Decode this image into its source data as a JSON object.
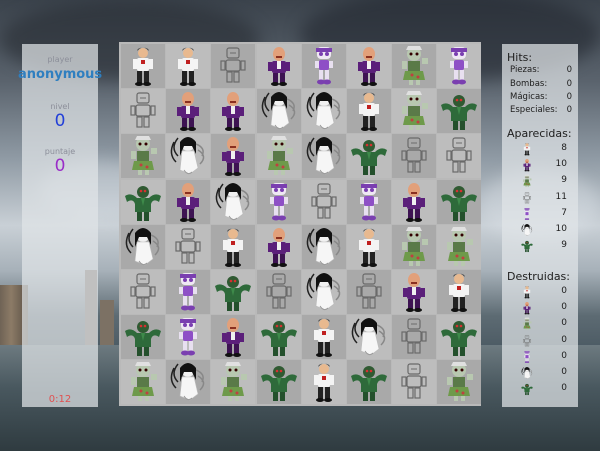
{
  "left_panel": {
    "player_label": "player",
    "player_name": "anonymous",
    "level_label": "nivel",
    "level_value": "0",
    "score_label": "puntaje",
    "score_value": "0",
    "timer": "0:12"
  },
  "right_panel": {
    "hits_title": "Hits:",
    "hits": [
      {
        "label": "Piezas:",
        "value": "0"
      },
      {
        "label": "Bombas:",
        "value": "0"
      },
      {
        "label": "Mágicas:",
        "value": "0"
      },
      {
        "label": "Especiales:",
        "value": "0"
      }
    ],
    "appeared_title": "Aparecidas:",
    "appeared": [
      {
        "icon": "man-white-shirt-icon",
        "value": "8"
      },
      {
        "icon": "bald-man-purple-suit-icon",
        "value": "10"
      },
      {
        "icon": "zombie-girl-icon",
        "value": "9"
      },
      {
        "icon": "gray-robot-icon",
        "value": "11"
      },
      {
        "icon": "purple-robot-icon",
        "value": "7"
      },
      {
        "icon": "ghost-girl-icon",
        "value": "10"
      },
      {
        "icon": "green-monster-icon",
        "value": "9"
      }
    ],
    "destroyed_title": "Destruidas:",
    "destroyed": [
      {
        "icon": "man-white-shirt-icon",
        "value": "0"
      },
      {
        "icon": "bald-man-purple-suit-icon",
        "value": "0"
      },
      {
        "icon": "zombie-girl-icon",
        "value": "0"
      },
      {
        "icon": "gray-robot-icon",
        "value": "0"
      },
      {
        "icon": "purple-robot-icon",
        "value": "0"
      },
      {
        "icon": "ghost-girl-icon",
        "value": "0"
      },
      {
        "icon": "green-monster-icon",
        "value": "0"
      }
    ]
  },
  "board": {
    "rows": [
      [
        "man",
        "man",
        "robot",
        "bald",
        "purple",
        "bald",
        "zombie",
        "purple"
      ],
      [
        "robot",
        "bald",
        "bald",
        "ghost",
        "ghost",
        "man",
        "zombie",
        "monster"
      ],
      [
        "zombie",
        "ghost",
        "bald",
        "zombie",
        "ghost",
        "monster",
        "robot",
        "robot"
      ],
      [
        "monster",
        "bald",
        "ghost",
        "purple",
        "robot",
        "purple",
        "bald",
        "monster"
      ],
      [
        "ghost",
        "robot",
        "man",
        "bald",
        "ghost",
        "man",
        "zombie",
        "zombie"
      ],
      [
        "robot",
        "purple",
        "monster",
        "robot",
        "ghost",
        "robot",
        "bald",
        "man"
      ],
      [
        "monster",
        "purple",
        "bald",
        "monster",
        "man",
        "ghost",
        "robot",
        "monster"
      ],
      [
        "zombie",
        "ghost",
        "zombie",
        "monster",
        "man",
        "monster",
        "robot",
        "zombie"
      ]
    ]
  },
  "colors": {
    "player_name": "#2f7fc0",
    "level": "#2340d8",
    "score": "#9a2cc8",
    "timer": "#e05050"
  }
}
